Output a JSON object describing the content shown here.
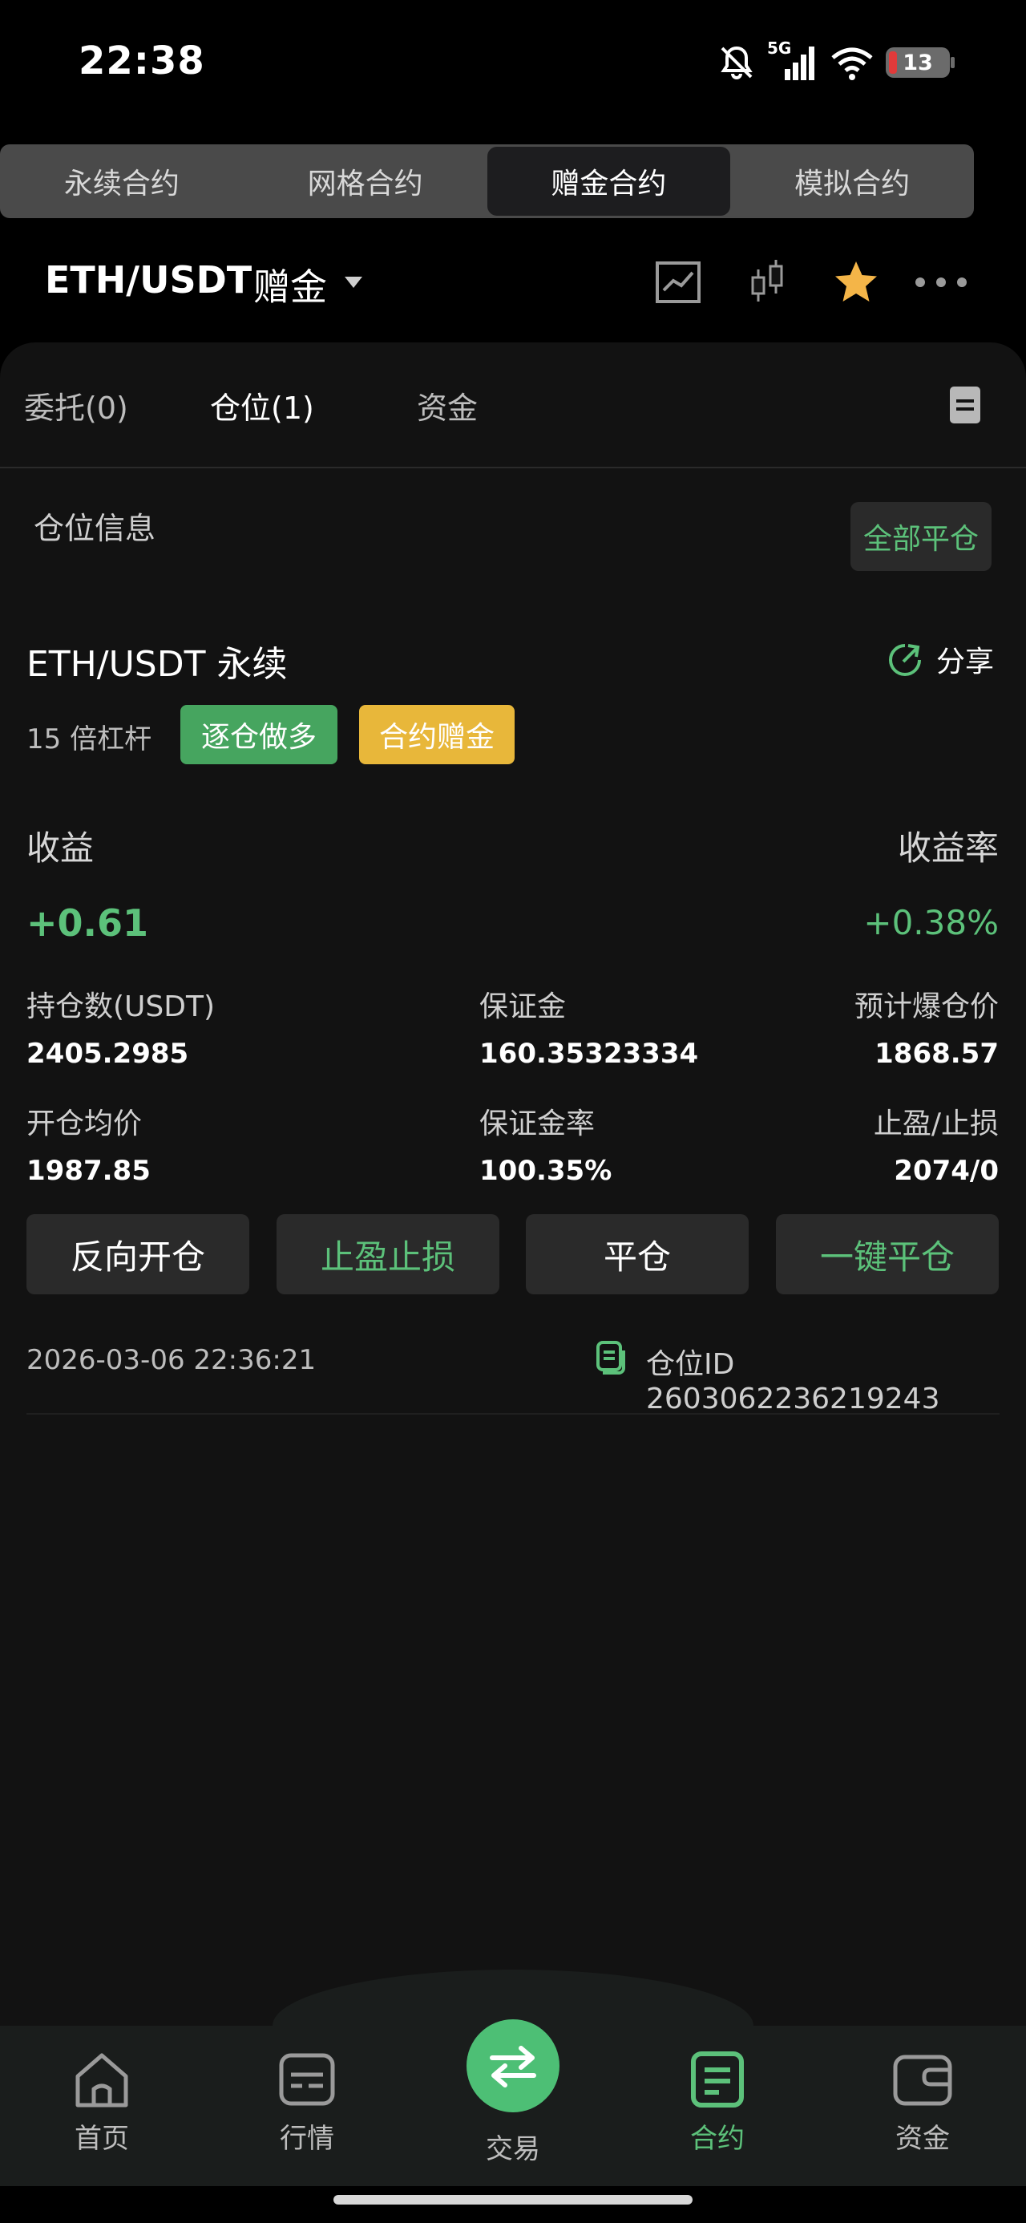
{
  "status_bar": {
    "time": "22:38",
    "network": "5G",
    "battery": "13"
  },
  "top_tabs": [
    {
      "label": "永续合约"
    },
    {
      "label": "网格合约"
    },
    {
      "label": "赠金合约"
    },
    {
      "label": "模拟合约"
    }
  ],
  "pair": {
    "symbol": "ETH/USDT",
    "mode": "赠金"
  },
  "sub_tabs": [
    {
      "label": "委托(0)"
    },
    {
      "label": "仓位(1)"
    },
    {
      "label": "资金"
    }
  ],
  "position_section": {
    "title": "仓位信息",
    "close_all_label": "全部平仓"
  },
  "position": {
    "name": "ETH/USDT 永续",
    "share_label": "分享",
    "leverage": "15 倍杠杆",
    "tag_side": "逐仓做多",
    "tag_bonus": "合约赠金",
    "pnl_label": "收益",
    "pnl_rate_label": "收益率",
    "pnl": "+0.61",
    "pnl_rate": "+0.38%",
    "size_label": "持仓数(USDT)",
    "size": "2405.2985",
    "margin_label": "保证金",
    "margin": "160.35323334",
    "liq_label": "预计爆仓价",
    "liq_price": "1868.57",
    "entry_label": "开仓均价",
    "entry_price": "1987.85",
    "margin_rate_label": "保证金率",
    "margin_rate": "100.35%",
    "tpsl_label": "止盈/止损",
    "tpsl": "2074/0",
    "timestamp": "2026-03-06 22:36:21",
    "position_id": "仓位ID 2603062236219243"
  },
  "actions": {
    "reverse": "反向开仓",
    "tpsl": "止盈止损",
    "close": "平仓",
    "one_click_close": "一键平仓"
  },
  "bottom_nav": {
    "home": "首页",
    "market": "行情",
    "trade": "交易",
    "contract": "合约",
    "assets": "资金"
  },
  "colors": {
    "accent_green": "#5cc17a",
    "bonus_yellow": "#e8b73a",
    "star": "#f4b548",
    "background": "#121212"
  }
}
